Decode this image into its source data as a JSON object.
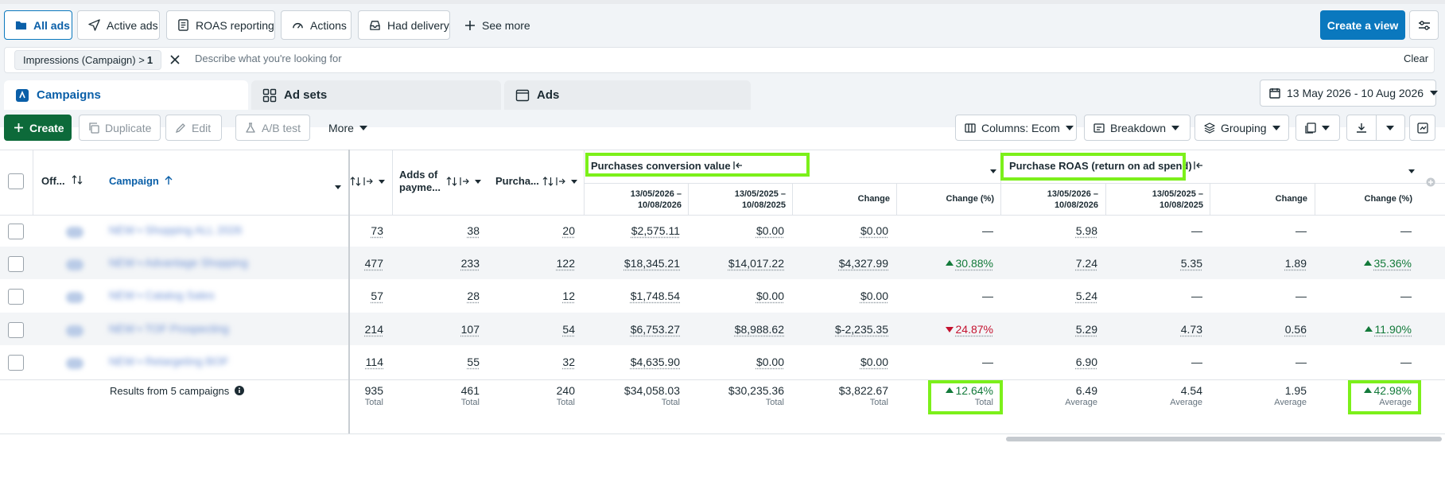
{
  "view_chips": [
    {
      "label": "All ads",
      "icon": "folder-icon"
    },
    {
      "label": "Active ads",
      "icon": "send-icon"
    },
    {
      "label": "ROAS reporting",
      "icon": "report-icon"
    },
    {
      "label": "Actions",
      "icon": "gauge-icon"
    },
    {
      "label": "Had delivery",
      "icon": "inbox-icon"
    },
    {
      "label": "See more",
      "icon": "plus-icon"
    }
  ],
  "header_actions": {
    "create_view": "Create a view"
  },
  "filter": {
    "chip_label": "Impressions (Campaign) >",
    "chip_value": "1",
    "placeholder": "Describe what you're looking for",
    "clear": "Clear"
  },
  "level_tabs": [
    {
      "label": "Campaigns",
      "active": true
    },
    {
      "label": "Ad sets",
      "active": false
    },
    {
      "label": "Ads",
      "active": false
    }
  ],
  "date_range": "13 May 2026 - 10 Aug 2026",
  "toolbar": {
    "create": "Create",
    "duplicate": "Duplicate",
    "edit": "Edit",
    "ab_test": "A/B test",
    "more": "More",
    "columns": "Columns: Ecom",
    "breakdown": "Breakdown",
    "grouping": "Grouping"
  },
  "table": {
    "headers": {
      "off": "Off...",
      "campaign": "Campaign",
      "adds_payment_1": "Adds of",
      "adds_payment_2": "payme...",
      "purchases": "Purcha...",
      "group_pcv": "Purchases conversion value",
      "group_roas": "Purchase ROAS (return on ad spend)"
    },
    "subheaders": {
      "current": [
        "13/05/2026 –",
        "10/08/2026"
      ],
      "previous": [
        "13/05/2025 –",
        "10/08/2025"
      ],
      "change": "Change",
      "change_pct": "Change (%)"
    },
    "rows": [
      {
        "campaign": "NEW ▪ Shopping ALL 2026",
        "impr": "73",
        "adds": "38",
        "purch": "20",
        "pcv_cur": "$2,575.11",
        "pcv_prev": "$0.00",
        "pcv_chg": "$0.00",
        "pcv_pct": "—",
        "roas_cur": "5.98",
        "roas_prev": "—",
        "roas_chg": "—",
        "roas_pct": "—"
      },
      {
        "campaign": "NEW ▪ Advantage Shopping",
        "impr": "477",
        "adds": "233",
        "purch": "122",
        "pcv_cur": "$18,345.21",
        "pcv_prev": "$14,017.22",
        "pcv_chg": "$4,327.99",
        "pcv_pct": "30.88%",
        "pcv_dir": "up",
        "roas_cur": "7.24",
        "roas_prev": "5.35",
        "roas_chg": "1.89",
        "roas_pct": "35.36%",
        "roas_dir": "up"
      },
      {
        "campaign": "NEW ▪ Catalog Sales",
        "impr": "57",
        "adds": "28",
        "purch": "12",
        "pcv_cur": "$1,748.54",
        "pcv_prev": "$0.00",
        "pcv_chg": "$0.00",
        "pcv_pct": "—",
        "roas_cur": "5.24",
        "roas_prev": "—",
        "roas_chg": "—",
        "roas_pct": "—"
      },
      {
        "campaign": "NEW ▪ TOF Prospecting",
        "impr": "214",
        "adds": "107",
        "purch": "54",
        "pcv_cur": "$6,753.27",
        "pcv_prev": "$8,988.62",
        "pcv_chg": "$-2,235.35",
        "pcv_pct": "24.87%",
        "pcv_dir": "down",
        "roas_cur": "5.29",
        "roas_prev": "4.73",
        "roas_chg": "0.56",
        "roas_pct": "11.90%",
        "roas_dir": "up"
      },
      {
        "campaign": "NEW ▪ Retargeting BOF",
        "impr": "114",
        "adds": "55",
        "purch": "32",
        "pcv_cur": "$4,635.90",
        "pcv_prev": "$0.00",
        "pcv_chg": "$0.00",
        "pcv_pct": "—",
        "roas_cur": "6.90",
        "roas_prev": "—",
        "roas_chg": "—",
        "roas_pct": "—"
      }
    ],
    "totals": {
      "label": "Results from 5 campaigns",
      "impr": {
        "value": "935",
        "label": "Total"
      },
      "adds": {
        "value": "461",
        "label": "Total"
      },
      "purch": {
        "value": "240",
        "label": "Total"
      },
      "pcv_cur": {
        "value": "$34,058.03",
        "label": "Total"
      },
      "pcv_prev": {
        "value": "$30,235.36",
        "label": "Total"
      },
      "pcv_chg": {
        "value": "$3,822.67",
        "label": "Total"
      },
      "pcv_pct": {
        "value": "12.64%",
        "label": "Total"
      },
      "roas_cur": {
        "value": "6.49",
        "label": "Average"
      },
      "roas_prev": {
        "value": "4.54",
        "label": "Average"
      },
      "roas_chg": {
        "value": "1.95",
        "label": "Average"
      },
      "roas_pct": {
        "value": "42.98%",
        "label": "Average"
      }
    }
  },
  "colors": {
    "brand": "#0a78be",
    "create": "#0d6a3a",
    "positive": "#137a3a",
    "negative": "#c4122f",
    "highlight": "#7cf01a"
  }
}
